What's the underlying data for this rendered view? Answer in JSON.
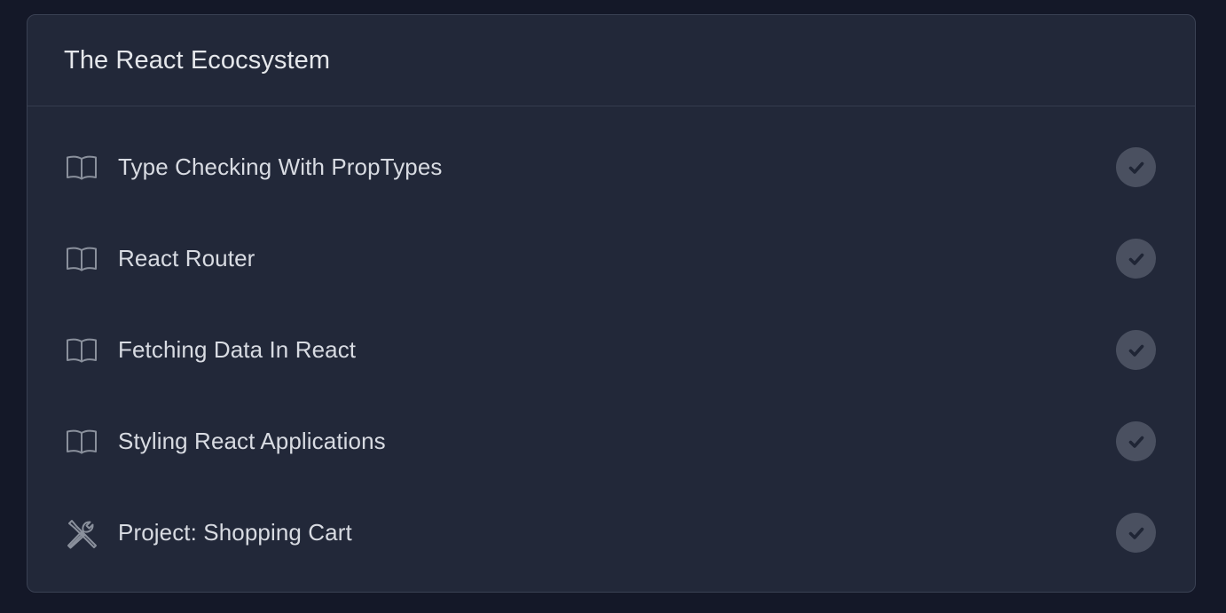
{
  "section": {
    "title": "The React Ecocsystem"
  },
  "lessons": [
    {
      "title": "Type Checking With PropTypes",
      "icon": "book-icon",
      "completed": true
    },
    {
      "title": "React Router",
      "icon": "book-icon",
      "completed": true
    },
    {
      "title": "Fetching Data In React",
      "icon": "book-icon",
      "completed": true
    },
    {
      "title": "Styling React Applications",
      "icon": "book-icon",
      "completed": true
    },
    {
      "title": "Project: Shopping Cart",
      "icon": "tools-icon",
      "completed": true
    }
  ],
  "colors": {
    "page_background": "#141828",
    "card_background": "#222839",
    "text": "#d8dbe2",
    "check_badge": "#4a5060",
    "check_mark": "#1f2535"
  }
}
